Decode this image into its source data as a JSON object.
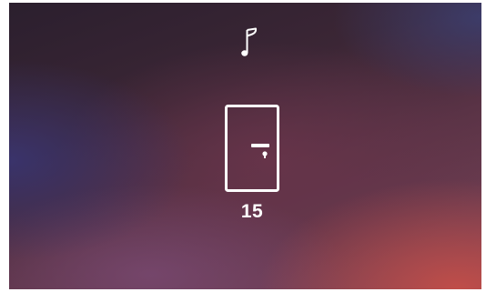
{
  "screen": {
    "top_icon": "music-note-icon",
    "center_icon": "door-icon",
    "door_count": "15"
  },
  "colors": {
    "foreground": "#ffffff"
  }
}
